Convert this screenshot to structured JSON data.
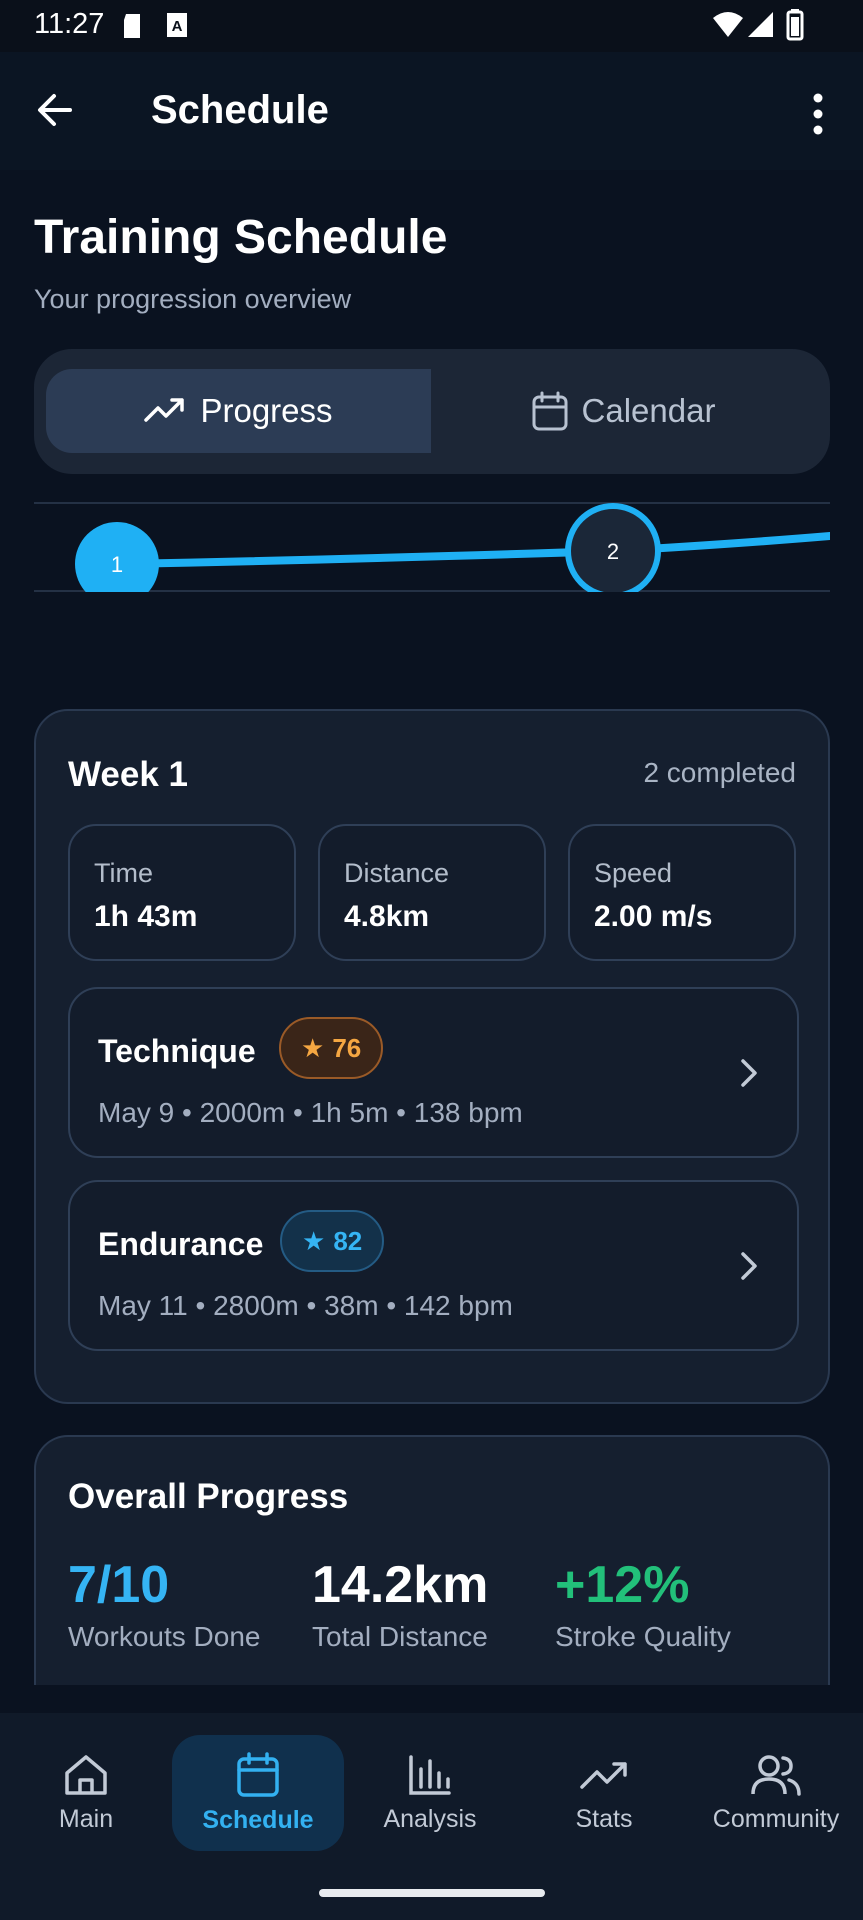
{
  "status_bar": {
    "time": "11:27"
  },
  "app_bar": {
    "title": "Schedule"
  },
  "header": {
    "title": "Training Schedule",
    "subtitle": "Your progression overview"
  },
  "view_toggle": {
    "options": [
      {
        "label": "Progress",
        "icon": "trending-up-icon",
        "selected": true
      },
      {
        "label": "Calendar",
        "icon": "calendar-icon",
        "selected": false
      }
    ]
  },
  "timeline": {
    "nodes": [
      {
        "label": "1",
        "state": "completed"
      },
      {
        "label": "2",
        "state": "current"
      }
    ]
  },
  "week": {
    "title": "Week 1",
    "status": "2 completed",
    "stats": [
      {
        "label": "Time",
        "value": "1h 43m"
      },
      {
        "label": "Distance",
        "value": "4.8km"
      },
      {
        "label": "Speed",
        "value": "2.00 m/s"
      }
    ],
    "sessions": [
      {
        "name": "Technique",
        "score": "76",
        "meta": "May 9 • 2000m • 1h 5m • 138 bpm",
        "badge_color": "#f5a742"
      },
      {
        "name": "Endurance",
        "score": "82",
        "meta": "May 11 • 2800m • 38m • 142 bpm",
        "badge_color": "#35b4f4"
      }
    ]
  },
  "overall": {
    "title": "Overall Progress",
    "metrics": [
      {
        "value": "7/10",
        "label": "Workouts Done",
        "color": "#35b4f4"
      },
      {
        "value": "14.2km",
        "label": "Total Distance",
        "color": "#ffffff"
      },
      {
        "value": "+12%",
        "label": "Stroke Quality",
        "color": "#22c07a"
      }
    ]
  },
  "bottom_nav": {
    "items": [
      {
        "label": "Main",
        "icon": "home-icon",
        "active": false
      },
      {
        "label": "Schedule",
        "icon": "calendar-icon",
        "active": true
      },
      {
        "label": "Analysis",
        "icon": "bar-chart-icon",
        "active": false
      },
      {
        "label": "Stats",
        "icon": "trending-up-icon",
        "active": false
      },
      {
        "label": "Community",
        "icon": "people-icon",
        "active": false
      }
    ]
  },
  "colors": {
    "accent": "#35b4f4",
    "background": "#0a1220",
    "card": "#151f2f",
    "success": "#22c07a",
    "warning": "#f5a742"
  }
}
